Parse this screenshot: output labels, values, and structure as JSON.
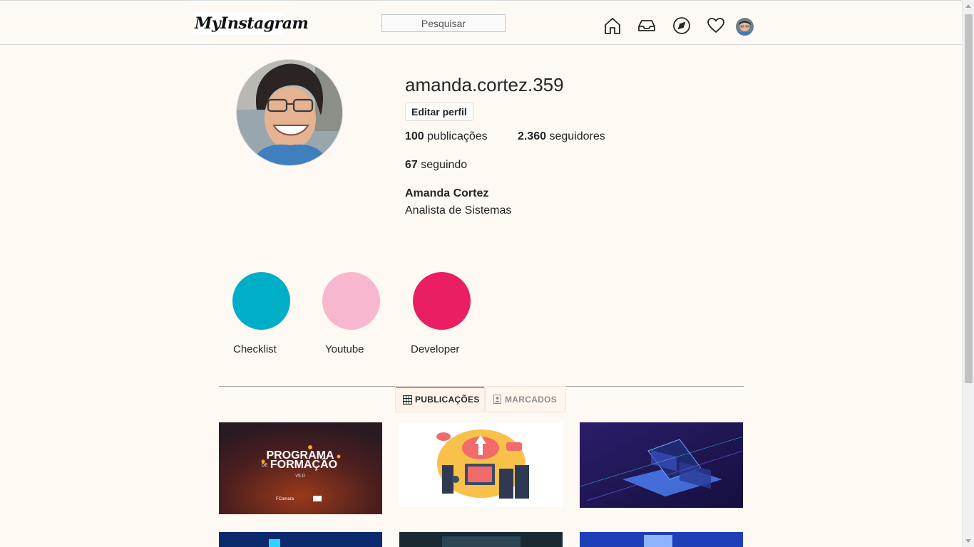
{
  "header": {
    "logo": "MyInstagram",
    "search_placeholder": "Pesquisar",
    "icons": [
      "home-icon",
      "inbox-icon",
      "explore-icon",
      "heart-icon",
      "avatar"
    ]
  },
  "profile": {
    "username": "amanda.cortez.359",
    "edit_label": "Editar perfil",
    "posts_count": "100",
    "posts_label": "publicações",
    "followers_count": "2.360",
    "followers_label": "seguidores",
    "following_count": "67",
    "following_label": "seguindo",
    "full_name": "Amanda Cortez",
    "bio": "Analista de Sistemas"
  },
  "highlights": [
    {
      "label": "Checklist",
      "color": "#00aec7"
    },
    {
      "label": "Youtube",
      "color": "#f7b8cf"
    },
    {
      "label": "Developer",
      "color": "#e91e63"
    }
  ],
  "tabs": {
    "posts": "PUBLICAÇÕES",
    "tagged": "MARCADOS"
  },
  "posts": {
    "post1": {
      "line1": "PROGRAMA",
      "line2": "DE",
      "line3": "FORMAÇÃO",
      "version": "v5.0",
      "brand1": "FCamara"
    }
  },
  "colors": {
    "background": "#fff9f3",
    "border": "#dbdbdb",
    "text": "#262626",
    "muted": "#8e8e8e"
  }
}
